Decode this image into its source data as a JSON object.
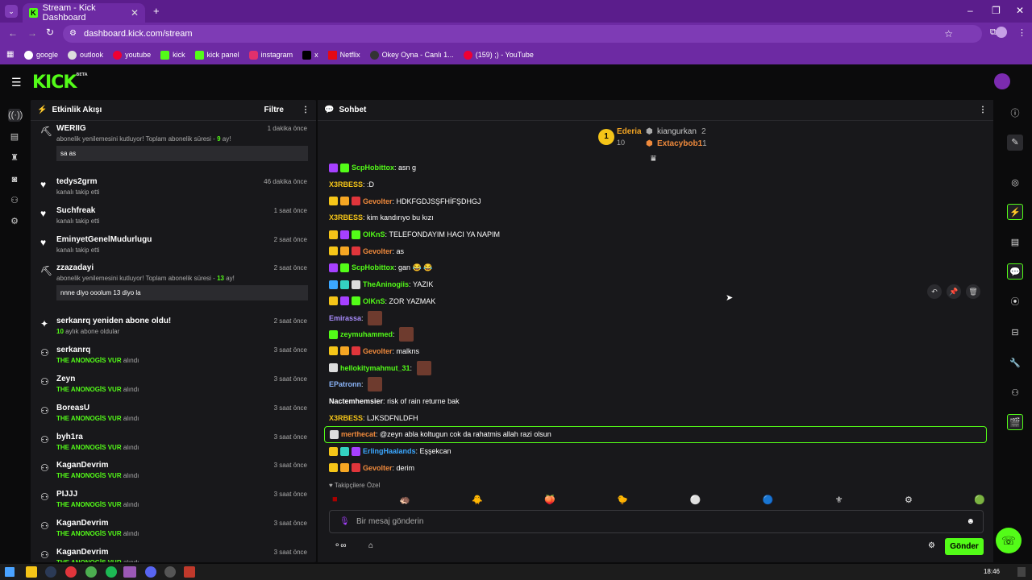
{
  "browser": {
    "tab_title": "Stream - Kick Dashboard",
    "url": "dashboard.kick.com/stream",
    "bookmarks": [
      "google",
      "outlook",
      "youtube",
      "kick",
      "kick panel",
      "instagram",
      "x",
      "Netflix",
      "Okey Oyna - Canlı 1...",
      "(159) ;) - YouTube"
    ]
  },
  "kick": {
    "logo": "KICK",
    "beta": "BETA"
  },
  "activity": {
    "title": "Etkinlik Akışı",
    "filter": "Filtre",
    "items": [
      {
        "name": "WERIIG",
        "time": "1 dakika önce",
        "sub": "abonelik yenilemesini kutluyor! Toplam abonelik süresi - ",
        "highlight": "9",
        "sub_end": " ay!",
        "message": "sa as"
      },
      {
        "name": "tedys2grm",
        "time": "46 dakika önce",
        "sub": "kanalı takip etti"
      },
      {
        "name": "Suchfreak",
        "time": "1 saat önce",
        "sub": "kanalı takip etti"
      },
      {
        "name": "EminyetGenelMudurlugu",
        "time": "2 saat önce",
        "sub": "kanalı takip etti"
      },
      {
        "name": "zzazadayi",
        "time": "2 saat önce",
        "sub": "abonelik yenilemesini kutluyor! Toplam abonelik süresi - ",
        "highlight": "13",
        "sub_end": " ay!",
        "message": "nnne diyo ooolum 13 diyo la"
      },
      {
        "name": "serkanrq yeniden abone oldu!",
        "time": "2 saat önce",
        "highlight": "10",
        "sub_end": " aylık abone oldular"
      },
      {
        "name": "serkanrq",
        "time": "3 saat önce",
        "highlight": "THE ANONOGİS VUR",
        "sub_end": " alındı"
      },
      {
        "name": "Zeyn",
        "time": "3 saat önce",
        "highlight": "THE ANONOGİS VUR",
        "sub_end": " alındı"
      },
      {
        "name": "BoreasU",
        "time": "3 saat önce",
        "highlight": "THE ANONOGİS VUR",
        "sub_end": " alındı"
      },
      {
        "name": "byh1ra",
        "time": "3 saat önce",
        "highlight": "THE ANONOGİS VUR",
        "sub_end": " alındı"
      },
      {
        "name": "KaganDevrim",
        "time": "3 saat önce",
        "highlight": "THE ANONOGİS VUR",
        "sub_end": " alındı"
      },
      {
        "name": "PIJJJ",
        "time": "3 saat önce",
        "highlight": "THE ANONOGİS VUR",
        "sub_end": " alındı"
      },
      {
        "name": "KaganDevrim",
        "time": "3 saat önce",
        "highlight": "THE ANONOGİS VUR",
        "sub_end": " alındı"
      },
      {
        "name": "KaganDevrim",
        "time": "3 saat önce",
        "highlight": "THE ANONOGİS VUR",
        "sub_end": " alındı"
      }
    ]
  },
  "chat": {
    "title": "Sohbet",
    "leaderboard": {
      "first": {
        "name": "Ederia",
        "count": "10"
      },
      "second": {
        "name": "kiangurkan",
        "count": "2"
      },
      "third": {
        "name": "Extacybob1",
        "count": "1"
      }
    },
    "messages": [
      {
        "user": "ScpHobittox",
        "color": "#53fc18",
        "text": "asn g",
        "badges": [
          "#a640ff",
          "#53fc18"
        ]
      },
      {
        "user": "X3RBESS",
        "color": "#f5c518",
        "text": ":D",
        "badges": []
      },
      {
        "user": "Gevolter",
        "color": "#f08a3c",
        "text": "HDKFGDJSŞFHİFŞDHGJ",
        "badges": [
          "#f5c518",
          "#f5a623",
          "#e0353b"
        ]
      },
      {
        "user": "X3RBESS",
        "color": "#f5c518",
        "text": "kim kandırıyo bu kızı",
        "badges": []
      },
      {
        "user": "OlKnS",
        "color": "#53fc18",
        "text": "TELEFONDAYIM HACI YA NAPIM",
        "badges": [
          "#f5c518",
          "#a640ff",
          "#53fc18"
        ]
      },
      {
        "user": "Gevolter",
        "color": "#f08a3c",
        "text": "as",
        "badges": [
          "#f5c518",
          "#f5a623",
          "#e0353b"
        ]
      },
      {
        "user": "ScpHobittox",
        "color": "#53fc18",
        "text": "gan 😂 😂",
        "badges": [
          "#a640ff",
          "#53fc18"
        ]
      },
      {
        "user": "TheAninogiis",
        "color": "#53fc18",
        "text": "YAZIK",
        "badges": [
          "#3ba7ff",
          "#34d1c2",
          "#dddddd"
        ]
      },
      {
        "user": "OlKnS",
        "color": "#53fc18",
        "text": "ZOR YAZMAK",
        "badges": [
          "#f5c518",
          "#a640ff",
          "#53fc18"
        ]
      },
      {
        "user": "Emirassa",
        "color": "#a78bfa",
        "text": "",
        "badges": [],
        "emote": true
      },
      {
        "user": "zeymuhammed",
        "color": "#53fc18",
        "text": "",
        "badges": [
          "#53fc18"
        ],
        "emote": true
      },
      {
        "user": "Gevolter",
        "color": "#f08a3c",
        "text": "malkns",
        "badges": [
          "#f5c518",
          "#f5a623",
          "#e0353b"
        ]
      },
      {
        "user": "hellokitymahmut_31",
        "color": "#53fc18",
        "text": "",
        "badges": [
          "#dddddd"
        ],
        "emote": true
      },
      {
        "user": "EPatronn",
        "color": "#8ab4f8",
        "text": "",
        "badges": [],
        "emote": true
      },
      {
        "user": "Nactemhemsier",
        "color": "#ffffff",
        "text": "risk of rain returne bak",
        "badges": []
      },
      {
        "user": "X3RBESS",
        "color": "#f5c518",
        "text": "LJKSDFNLDFH",
        "badges": []
      },
      {
        "user": "merthecat",
        "color": "#f08a3c",
        "text": "@zeyn abla koltugun cok da rahatmis allah razi olsun",
        "badges": [
          "#dddddd"
        ],
        "highlight": true
      },
      {
        "user": "ErlingHaalands",
        "color": "#3ba7ff",
        "text": "Eşşekcan",
        "badges": [
          "#f5c518",
          "#34d1c2",
          "#a640ff"
        ]
      },
      {
        "user": "Gevolter",
        "color": "#f08a3c",
        "text": "derim",
        "badges": [
          "#f5c518",
          "#f5a623",
          "#e0353b"
        ]
      }
    ],
    "follower_label": "Takipçilere Özel",
    "input_placeholder": "Bir mesaj gönderin",
    "send_label": "Gönder"
  },
  "taskbar": {
    "time": "18:46"
  }
}
